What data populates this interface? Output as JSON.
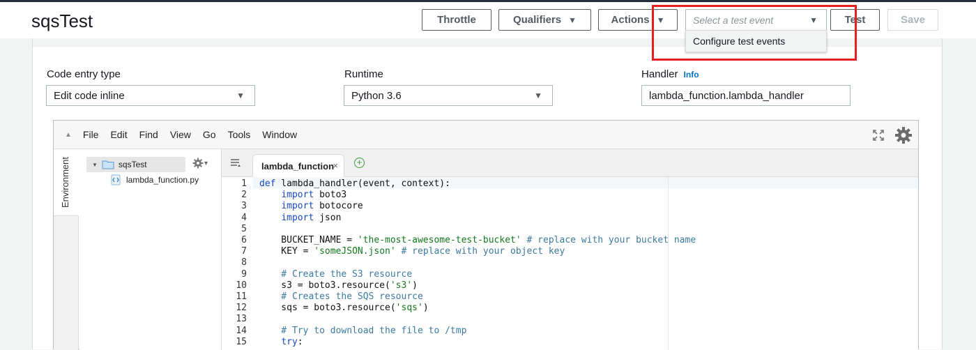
{
  "header": {
    "title": "sqsTest",
    "buttons": {
      "throttle": "Throttle",
      "qualifiers": "Qualifiers",
      "actions": "Actions",
      "test": "Test",
      "save": "Save"
    },
    "test_event_select": {
      "placeholder": "Select a test event"
    },
    "dropdown_item": "Configure test events"
  },
  "colors": {
    "highlight": "#e8201d",
    "info_link": "#0073bb"
  },
  "config": {
    "code_entry_type": {
      "label": "Code entry type",
      "value": "Edit code inline"
    },
    "runtime": {
      "label": "Runtime",
      "value": "Python 3.6"
    },
    "handler": {
      "label": "Handler",
      "info": "Info",
      "value": "lambda_function.lambda_handler"
    }
  },
  "ide": {
    "menu": [
      "File",
      "Edit",
      "Find",
      "View",
      "Go",
      "Tools",
      "Window"
    ],
    "side_tab": "Environment",
    "tree": {
      "root": "sqsTest",
      "file": "lambda_function.py"
    },
    "tab": {
      "label": "lambda_function",
      "close": "×"
    },
    "icons": [
      "collapse-triangle-icon",
      "fullscreen-icon",
      "settings-gear-icon",
      "folder-icon",
      "python-file-icon",
      "add-tab-icon",
      "file-list-icon"
    ],
    "lines": [
      {
        "n": "1",
        "tokens": [
          [
            "kw",
            "def"
          ],
          [
            "txt",
            " lambda_handler(event, context):"
          ]
        ]
      },
      {
        "n": "2",
        "tokens": [
          [
            "txt",
            "    "
          ],
          [
            "kw",
            "import"
          ],
          [
            "txt",
            " boto3"
          ]
        ]
      },
      {
        "n": "3",
        "tokens": [
          [
            "txt",
            "    "
          ],
          [
            "kw",
            "import"
          ],
          [
            "txt",
            " botocore"
          ]
        ]
      },
      {
        "n": "4",
        "tokens": [
          [
            "txt",
            "    "
          ],
          [
            "kw",
            "import"
          ],
          [
            "txt",
            " json"
          ]
        ]
      },
      {
        "n": "5",
        "tokens": []
      },
      {
        "n": "6",
        "tokens": [
          [
            "txt",
            "    BUCKET_NAME = "
          ],
          [
            "str",
            "'the-most-awesome-test-bucket'"
          ],
          [
            "cm",
            " # replace with your bucket name"
          ]
        ]
      },
      {
        "n": "7",
        "tokens": [
          [
            "txt",
            "    KEY = "
          ],
          [
            "str",
            "'someJSON.json'"
          ],
          [
            "cm",
            " # replace with your object key"
          ]
        ]
      },
      {
        "n": "8",
        "tokens": []
      },
      {
        "n": "9",
        "tokens": [
          [
            "cm",
            "    # Create the S3 resource"
          ]
        ]
      },
      {
        "n": "10",
        "tokens": [
          [
            "txt",
            "    s3 = boto3.resource("
          ],
          [
            "str",
            "'s3'"
          ],
          [
            "txt",
            ")"
          ]
        ]
      },
      {
        "n": "11",
        "tokens": [
          [
            "cm",
            "    # Creates the SQS resource"
          ]
        ]
      },
      {
        "n": "12",
        "tokens": [
          [
            "txt",
            "    sqs = boto3.resource("
          ],
          [
            "str",
            "'sqs'"
          ],
          [
            "txt",
            ")"
          ]
        ]
      },
      {
        "n": "13",
        "tokens": []
      },
      {
        "n": "14",
        "tokens": [
          [
            "cm",
            "    # Try to download the file to /tmp"
          ]
        ]
      },
      {
        "n": "15",
        "tokens": [
          [
            "txt",
            "    "
          ],
          [
            "kw",
            "try"
          ],
          [
            "txt",
            ":"
          ]
        ]
      }
    ]
  }
}
